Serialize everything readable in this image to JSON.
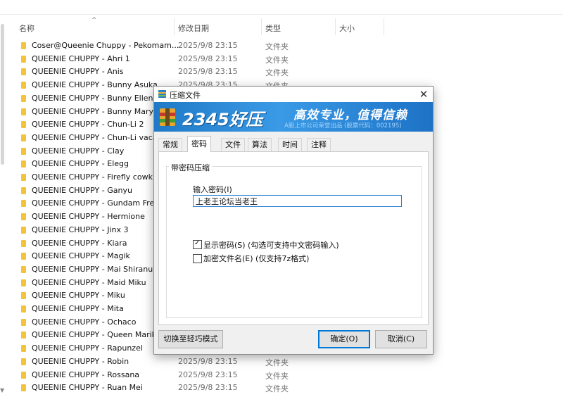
{
  "explorer": {
    "columns": {
      "name": "名称",
      "date": "修改日期",
      "type": "类型",
      "size": "大小"
    },
    "rows": [
      {
        "name": "Coser@Queenie Chuppy - Pekomam...",
        "date": "2025/9/8 23:15",
        "type": "文件夹"
      },
      {
        "name": "QUEENIE CHUPPY - Ahri 1",
        "date": "2025/9/8 23:15",
        "type": "文件夹"
      },
      {
        "name": "QUEENIE CHUPPY - Anis",
        "date": "2025/9/8 23:15",
        "type": "文件夹"
      },
      {
        "name": "QUEENIE CHUPPY - Bunny Asuka",
        "date": "2025/9/8 23:15",
        "type": "文件夹"
      },
      {
        "name": "QUEENIE CHUPPY - Bunny Ellen Joe",
        "date": "",
        "type": ""
      },
      {
        "name": "QUEENIE CHUPPY - Bunny Mary",
        "date": "",
        "type": ""
      },
      {
        "name": "QUEENIE CHUPPY - Chun-Li 2",
        "date": "",
        "type": ""
      },
      {
        "name": "QUEENIE CHUPPY - Chun-Li vacatio",
        "date": "",
        "type": ""
      },
      {
        "name": "QUEENIE CHUPPY - Clay",
        "date": "",
        "type": ""
      },
      {
        "name": "QUEENIE CHUPPY - Elegg",
        "date": "",
        "type": ""
      },
      {
        "name": "QUEENIE CHUPPY - Firefly cowkini",
        "date": "",
        "type": ""
      },
      {
        "name": "QUEENIE CHUPPY - Ganyu",
        "date": "",
        "type": ""
      },
      {
        "name": "QUEENIE CHUPPY - Gundam Freedo",
        "date": "",
        "type": ""
      },
      {
        "name": "QUEENIE CHUPPY - Hermione",
        "date": "",
        "type": ""
      },
      {
        "name": "QUEENIE CHUPPY - Jinx 3",
        "date": "",
        "type": ""
      },
      {
        "name": "QUEENIE CHUPPY - Kiara",
        "date": "",
        "type": ""
      },
      {
        "name": "QUEENIE CHUPPY - Magik",
        "date": "",
        "type": ""
      },
      {
        "name": "QUEENIE CHUPPY - Mai Shiranui",
        "date": "",
        "type": ""
      },
      {
        "name": "QUEENIE CHUPPY - Maid Miku",
        "date": "",
        "type": ""
      },
      {
        "name": "QUEENIE CHUPPY - Miku",
        "date": "",
        "type": ""
      },
      {
        "name": "QUEENIE CHUPPY - Mita",
        "date": "",
        "type": ""
      },
      {
        "name": "QUEENIE CHUPPY - Ochaco",
        "date": "",
        "type": ""
      },
      {
        "name": "QUEENIE CHUPPY - Queen Marika",
        "date": "",
        "type": ""
      },
      {
        "name": "QUEENIE CHUPPY - Rapunzel",
        "date": "",
        "type": ""
      },
      {
        "name": "QUEENIE CHUPPY - Robin",
        "date": "2025/9/8 23:15",
        "type": "文件夹"
      },
      {
        "name": "QUEENIE CHUPPY - Rossana",
        "date": "2025/9/8 23:15",
        "type": "文件夹"
      },
      {
        "name": "QUEENIE CHUPPY - Ruan Mei",
        "date": "2025/9/8 23:15",
        "type": "文件夹"
      }
    ],
    "folder_color": "#f3c33b"
  },
  "dialog": {
    "title": "压缩文件",
    "banner": {
      "brand": "2345好压",
      "slogan": "高效专业，值得信赖",
      "sub": "A股上市公司荣誉出品 (股票代码：002195)"
    },
    "tabs": [
      "常规",
      "密码",
      "文件",
      "算法",
      "时间",
      "注释"
    ],
    "active_tab": "密码",
    "group_title": "带密码压缩",
    "password_label": "输入密码(I)",
    "password_value": "上老王论坛当老王",
    "show_password": {
      "label": "显示密码(S)  (勾选可支持中文密码输入)",
      "checked": true
    },
    "encrypt_names": {
      "label": "加密文件名(E)  (仅支持7z格式)",
      "checked": false
    },
    "buttons": {
      "light_mode": "切换至轻巧模式",
      "ok": "确定(O)",
      "cancel": "取消(C)"
    }
  }
}
